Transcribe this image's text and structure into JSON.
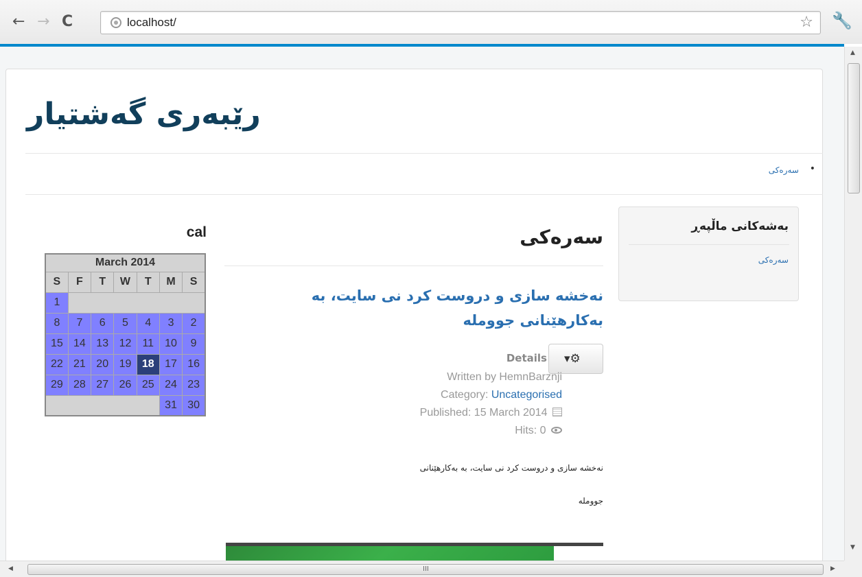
{
  "browser": {
    "url": "localhost/",
    "back_glyph": "←",
    "forward_glyph": "→",
    "reload_glyph": "C",
    "star_glyph": "☆",
    "wrench_glyph": "🔧",
    "accent_color": "#0088cc"
  },
  "site": {
    "title": "رێبەری گەشتیار",
    "breadcrumb_home": "سەرەکی"
  },
  "sidebar_menu": {
    "title": "بەشەکانی ماڵپەڕ",
    "items": [
      "سەرەکی"
    ]
  },
  "article": {
    "page_heading": "سەرەکی",
    "title": "نەخشە سازی و دروست کرد نی سایت، بە بەکارهێنانی جوومله",
    "details_label": "Details",
    "author": "Written by HemnBarznji",
    "category_label": "Category: ",
    "category_value": "Uncategorised",
    "published": "Published: 15 March 2014",
    "hits": "Hits: 0",
    "intro_line1": "نەخشە سازی و دروست کرد نی سایت، بە بەکارهێنانی",
    "intro_line2": "جوومله"
  },
  "calendar": {
    "module_title": "cal",
    "month": "March 2014",
    "weekdays": [
      "S",
      "F",
      "T",
      "W",
      "T",
      "M",
      "S"
    ],
    "rows": [
      [
        "1",
        "",
        "",
        "",
        "",
        "",
        ""
      ],
      [
        "8",
        "7",
        "6",
        "5",
        "4",
        "3",
        "2"
      ],
      [
        "15",
        "14",
        "13",
        "12",
        "11",
        "10",
        "9"
      ],
      [
        "22",
        "21",
        "20",
        "19",
        "18",
        "17",
        "16"
      ],
      [
        "29",
        "28",
        "27",
        "26",
        "25",
        "24",
        "23"
      ],
      [
        "",
        "",
        "",
        "",
        "",
        "31",
        "30"
      ]
    ],
    "today": "18",
    "day_color": "#8080ff",
    "today_color": "#2b3f7a"
  },
  "scrollbars": {
    "up_glyph": "▲",
    "down_glyph": "▼",
    "left_glyph": "◀",
    "right_glyph": "▶",
    "grip_glyph": "III"
  }
}
